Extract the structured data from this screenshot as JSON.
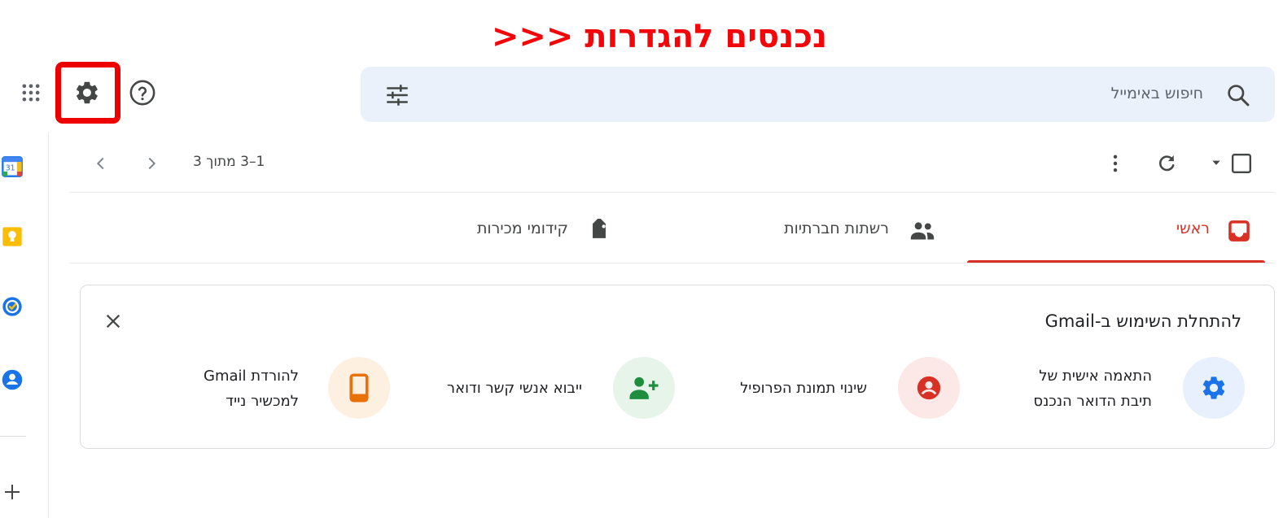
{
  "annotation": {
    "text": "נכנסים להגדרות <<<"
  },
  "header": {
    "search": {
      "placeholder": "חיפוש באימייל"
    }
  },
  "toolbar": {
    "pagination": "1–3 מתוך 3"
  },
  "tabs": [
    {
      "label": "ראשי",
      "active": true,
      "icon": "inbox-icon"
    },
    {
      "label": "רשתות חברתיות",
      "active": false,
      "icon": "people-icon"
    },
    {
      "label": "קידומי מכירות",
      "active": false,
      "icon": "tag-icon"
    }
  ],
  "getting_started": {
    "title": "להתחלת השימוש ב-Gmail",
    "items": [
      {
        "label": "התאמה אישית של\nתיבת הדואר הנכנס",
        "icon": "gear-icon",
        "color": "#1a73e8",
        "bg": "#e8f0fe"
      },
      {
        "label": "שינוי תמונת הפרופיל",
        "icon": "account-circle-icon",
        "color": "#d93025",
        "bg": "#fce8e6"
      },
      {
        "label": "ייבוא אנשי קשר ודואר",
        "icon": "person-add-icon",
        "color": "#1e8e3e",
        "bg": "#e6f4ea"
      },
      {
        "label": "להורדת Gmail\nלמכשיר נייד",
        "icon": "smartphone-icon",
        "color": "#e8710a",
        "bg": "#fef0e1"
      }
    ]
  },
  "colors": {
    "annotation": "#f2060a",
    "highlight": "#ee0000",
    "active_tab": "#d93025",
    "search_bg": "#eaf1fb"
  }
}
